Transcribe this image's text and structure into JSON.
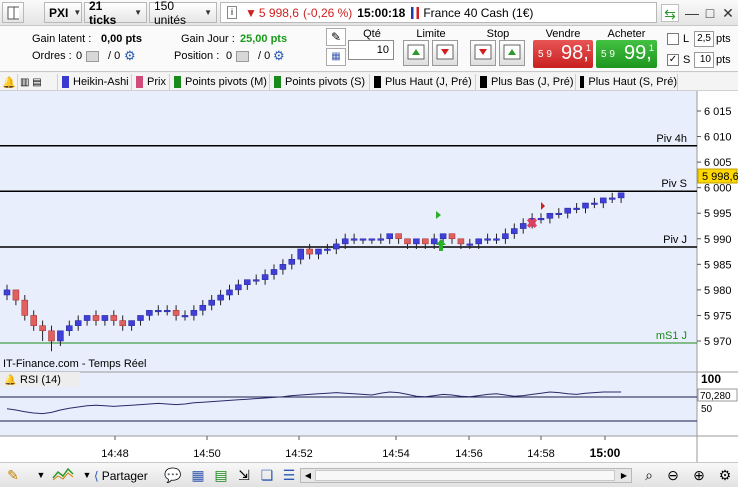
{
  "toolbar": {
    "symbol_label": "PXI",
    "interval_label": "21 ticks",
    "units_label": "150 unités",
    "last_price": "5 998,6",
    "change": "(-0,26 %)",
    "time": "15:00:18",
    "instrument": "France 40 Cash (1€)"
  },
  "panel": {
    "gain_latent_label": "Gain latent :",
    "gain_latent_value": "0,00 pts",
    "orders_label": "Ordres :",
    "orders_value": "0",
    "orders_sep": "/ 0",
    "gain_jour_label": "Gain Jour :",
    "gain_jour_value": "25,00 pts",
    "position_label": "Position :",
    "position_value": "0",
    "position_sep": "/ 0",
    "qty_title": "Qté",
    "qty_value": "10",
    "limit_title": "Limite",
    "stop_title": "Stop",
    "sell_title": "Vendre",
    "buy_title": "Acheter",
    "sell_prefix": "5 9",
    "sell_big": "98,",
    "sell_sup": "1",
    "buy_prefix": "5 9",
    "buy_big": "99,",
    "buy_sup": "1",
    "l_label": "L",
    "l_value": "2,5",
    "s_label": "S",
    "s_value": "10",
    "pts": "pts"
  },
  "indicators": [
    {
      "label": "Heikin-Ashi",
      "color": "#3a3ad0"
    },
    {
      "label": "Prix",
      "color": "#d04a7a"
    },
    {
      "label": "Points pivots (M)",
      "color": "#1a8a1a"
    },
    {
      "label": "Points pivots (S)",
      "color": "#1a8a1a"
    },
    {
      "label": "Plus Haut (J, Pré)",
      "color": "#000000"
    },
    {
      "label": "Plus Bas (J, Pré)",
      "color": "#000000"
    },
    {
      "label": "Plus Haut (S, Pré)",
      "color": "#000000"
    }
  ],
  "chart": {
    "watermark": "IT-Finance.com - Temps Réel",
    "y_ticks": [
      "6 015",
      "6 010",
      "6 005",
      "6 000",
      "5 995",
      "5 990",
      "5 985",
      "5 980",
      "5 975",
      "5 970"
    ],
    "y_values": [
      6015,
      6010,
      6005,
      6000,
      5995,
      5990,
      5985,
      5980,
      5975,
      5970
    ],
    "price_tag": "5 998,6",
    "levels": [
      {
        "label": "Piv 4h",
        "value": 6008.2,
        "color": "#000000"
      },
      {
        "label": "Piv S",
        "value": 5999.3,
        "color": "#000000"
      },
      {
        "label": "Piv J",
        "value": 5988.4,
        "color": "#000000"
      },
      {
        "label": "mS1 J",
        "value": 5969.6,
        "color": "#1a8a1a"
      }
    ],
    "x_ticks": [
      "14:48",
      "14:50",
      "14:52",
      "14:54",
      "14:56",
      "14:58",
      "15:00"
    ],
    "rsi_label": "RSI (14)",
    "rsi_ticks": [
      "100",
      "50"
    ],
    "rsi_value": "70,280"
  },
  "chart_data": {
    "type": "candlestick",
    "series": [
      {
        "name": "Heikin-Ashi",
        "values": [
          [
            5979,
            5981,
            5978,
            5980
          ],
          [
            5980,
            5980,
            5977,
            5978
          ],
          [
            5978,
            5979,
            5974,
            5975
          ],
          [
            5975,
            5976,
            5972,
            5973
          ],
          [
            5973,
            5974,
            5970,
            5972
          ],
          [
            5972,
            5973,
            5968,
            5970
          ],
          [
            5970,
            5972,
            5969,
            5972
          ],
          [
            5972,
            5974,
            5971,
            5973
          ],
          [
            5973,
            5975,
            5972,
            5974
          ],
          [
            5974,
            5975,
            5973,
            5975
          ],
          [
            5975,
            5976,
            5973,
            5974
          ],
          [
            5974,
            5975,
            5973,
            5975
          ],
          [
            5975,
            5976,
            5973,
            5974
          ],
          [
            5974,
            5975,
            5972,
            5973
          ],
          [
            5973,
            5974,
            5972,
            5974
          ],
          [
            5974,
            5975,
            5973,
            5975
          ],
          [
            5975,
            5976,
            5974,
            5976
          ],
          [
            5976,
            5977,
            5975,
            5976
          ],
          [
            5976,
            5977,
            5975,
            5976
          ],
          [
            5976,
            5977,
            5974,
            5975
          ],
          [
            5975,
            5976,
            5974,
            5975
          ],
          [
            5975,
            5977,
            5974,
            5976
          ],
          [
            5976,
            5978,
            5975,
            5977
          ],
          [
            5977,
            5979,
            5976,
            5978
          ],
          [
            5978,
            5980,
            5977,
            5979
          ],
          [
            5979,
            5981,
            5978,
            5980
          ],
          [
            5980,
            5982,
            5979,
            5981
          ],
          [
            5981,
            5982,
            5980,
            5982
          ],
          [
            5982,
            5983,
            5981,
            5982
          ],
          [
            5982,
            5984,
            5981,
            5983
          ],
          [
            5983,
            5985,
            5982,
            5984
          ],
          [
            5984,
            5986,
            5983,
            5985
          ],
          [
            5985,
            5987,
            5984,
            5986
          ],
          [
            5986,
            5988,
            5985,
            5988
          ],
          [
            5988,
            5989,
            5986,
            5987
          ],
          [
            5987,
            5988,
            5986,
            5988
          ],
          [
            5988,
            5989,
            5987,
            5988
          ],
          [
            5988,
            5990,
            5987,
            5989
          ],
          [
            5989,
            5991,
            5988,
            5990
          ],
          [
            5990,
            5991,
            5989,
            5990
          ],
          [
            5990,
            5990,
            5989,
            5990
          ],
          [
            5990,
            5990,
            5989,
            5990
          ],
          [
            5990,
            5991,
            5989,
            5990
          ],
          [
            5990,
            5991,
            5989,
            5991
          ],
          [
            5991,
            5991,
            5989,
            5990
          ],
          [
            5990,
            5990,
            5988,
            5989
          ],
          [
            5989,
            5990,
            5988,
            5990
          ],
          [
            5990,
            5990,
            5988,
            5989
          ],
          [
            5989,
            5991,
            5988,
            5990
          ],
          [
            5990,
            5991,
            5989,
            5991
          ],
          [
            5991,
            5991,
            5989,
            5990
          ],
          [
            5990,
            5990,
            5988,
            5989
          ],
          [
            5989,
            5990,
            5988,
            5989
          ],
          [
            5989,
            5990,
            5988,
            5990
          ],
          [
            5990,
            5991,
            5989,
            5990
          ],
          [
            5990,
            5991,
            5989,
            5990
          ],
          [
            5990,
            5992,
            5989,
            5991
          ],
          [
            5991,
            5993,
            5990,
            5992
          ],
          [
            5992,
            5994,
            5991,
            5993
          ],
          [
            5993,
            5995,
            5992,
            5994
          ],
          [
            5994,
            5995,
            5993,
            5994
          ],
          [
            5994,
            5995,
            5993,
            5995
          ],
          [
            5995,
            5996,
            5994,
            5995
          ],
          [
            5995,
            5996,
            5994,
            5996
          ],
          [
            5996,
            5997,
            5995,
            5996
          ],
          [
            5996,
            5997,
            5995,
            5997
          ],
          [
            5997,
            5998,
            5996,
            5997
          ],
          [
            5997,
            5998,
            5996,
            5998
          ],
          [
            5998,
            5999,
            5997,
            5998
          ],
          [
            5998,
            5999,
            5997,
            5999
          ]
        ]
      }
    ],
    "ylim": [
      5968,
      6016
    ]
  }
}
